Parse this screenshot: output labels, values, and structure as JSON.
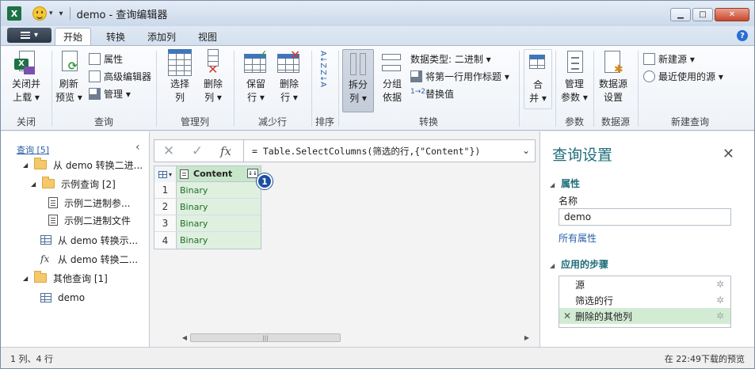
{
  "window": {
    "title": "demo - 查询编辑器",
    "app_icon": "X",
    "quick_access_drop": "▾",
    "buttons": {
      "minimize": "▁",
      "maximize": "□",
      "close": "✕"
    }
  },
  "tabs": [
    "开始",
    "转换",
    "添加列",
    "视图"
  ],
  "active_tab": "开始",
  "ribbon": {
    "close": {
      "label1": "关闭并",
      "label2": "上载 ▾",
      "group": "关闭"
    },
    "query": {
      "refresh1": "刷新",
      "refresh2": "预览 ▾",
      "properties": "属性",
      "advanced_editor": "高级编辑器",
      "manage": "管理 ▾",
      "group": "查询"
    },
    "manage_columns": {
      "choose1": "选择",
      "choose2": "列",
      "remove1": "删除",
      "remove2": "列 ▾",
      "group": "管理列"
    },
    "reduce_rows": {
      "keep1": "保留",
      "keep2": "行 ▾",
      "remove1": "删除",
      "remove2": "行 ▾",
      "group": "减少行"
    },
    "sort": {
      "group": "排序",
      "asc": "A↓Z",
      "desc": "Z↓A"
    },
    "transform": {
      "split1": "拆分",
      "split2": "列 ▾",
      "group1": "分组",
      "group2": "依据",
      "data_type": "数据类型: 二进制 ▾",
      "first_row_header": "将第一行用作标题 ▾",
      "replace_values": "替换值",
      "group": "转换"
    },
    "combine": {
      "label1": "合",
      "label2": "并 ▾"
    },
    "parameters": {
      "label1": "管理",
      "label2": "参数 ▾",
      "group": "参数"
    },
    "data_source": {
      "label1": "数据源",
      "label2": "设置",
      "group": "数据源"
    },
    "new_query": {
      "new_source": "新建源 ▾",
      "recent_sources": "最近使用的源 ▾",
      "group": "新建查询"
    }
  },
  "left_pane": {
    "title": "查询 [5]",
    "items": [
      {
        "label": "从 demo 转换二进...",
        "type": "folder",
        "level": 1
      },
      {
        "label": "示例查询 [2]",
        "type": "folder",
        "level": 2
      },
      {
        "label": "示例二进制参...",
        "type": "param",
        "level": 3
      },
      {
        "label": "示例二进制文件",
        "type": "doc",
        "level": 3
      },
      {
        "label": "从 demo 转换示...",
        "type": "table",
        "level": 2
      },
      {
        "label": "从 demo 转换二...",
        "type": "fx",
        "level": 2
      },
      {
        "label": "其他查询 [1]",
        "type": "folder",
        "level": 1
      },
      {
        "label": "demo",
        "type": "table",
        "level": 2
      }
    ]
  },
  "formula_bar": {
    "cancel": "✕",
    "confirm": "✓",
    "fx": "fx",
    "text": "= Table.SelectColumns(筛选的行,{\"Content\"})"
  },
  "grid": {
    "column": "Content",
    "rows": [
      "1",
      "2",
      "3",
      "4"
    ],
    "values": [
      "Binary",
      "Binary",
      "Binary",
      "Binary"
    ],
    "badge": "1",
    "expand": "↓↓"
  },
  "right_pane": {
    "title": "查询设置",
    "close": "✕",
    "properties_header": "属性",
    "name_label": "名称",
    "name_value": "demo",
    "all_properties": "所有属性",
    "steps_header": "应用的步骤",
    "steps": [
      "源",
      "筛选的行",
      "删除的其他列"
    ]
  },
  "status": {
    "left": "1 列、4 行",
    "right": "在 22:49下载的预览"
  }
}
